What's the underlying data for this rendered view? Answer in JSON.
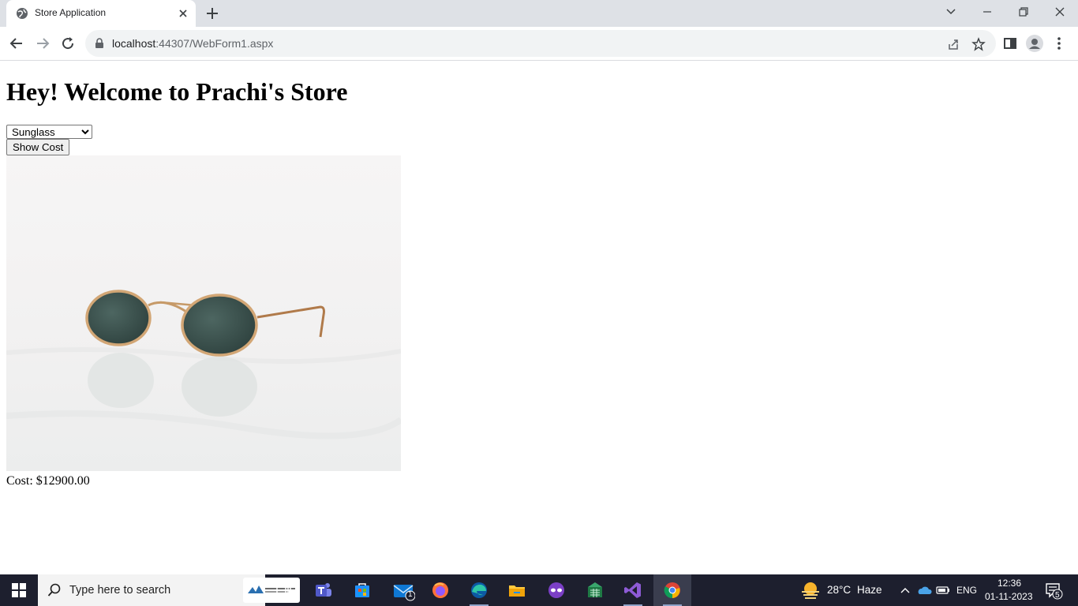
{
  "browser": {
    "tab_title": "Store Application",
    "url_host": "localhost",
    "url_rest": ":44307/WebForm1.aspx"
  },
  "page": {
    "heading": "Hey! Welcome to Prachi's Store",
    "product_select": {
      "selected": "Sunglass"
    },
    "show_cost_button": "Show Cost",
    "cost_text": "Cost: $12900.00"
  },
  "taskbar": {
    "search_placeholder": "Type here to search",
    "mail_badge": "1",
    "weather_temp": "28°C",
    "weather_text": "Haze",
    "language": "ENG",
    "time": "12:36",
    "date": "01-11-2023",
    "notification_count": "5"
  }
}
